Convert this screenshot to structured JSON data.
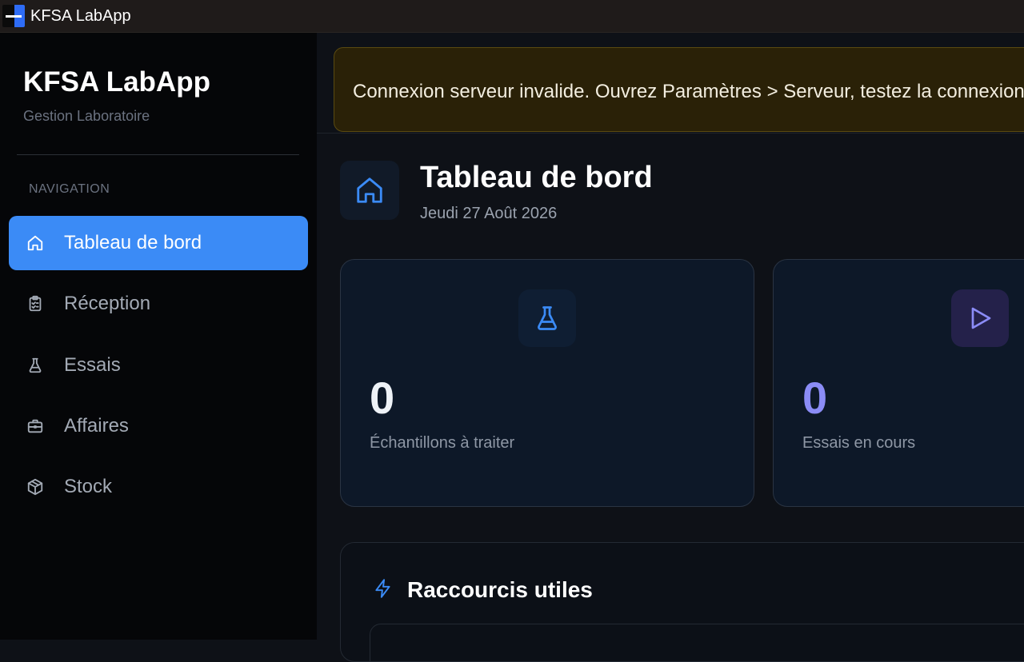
{
  "window": {
    "title": "KFSA LabApp"
  },
  "sidebar": {
    "brand_title": "KFSA LabApp",
    "brand_subtitle": "Gestion Laboratoire",
    "nav_heading": "NAVIGATION",
    "items": [
      {
        "label": "Tableau de bord",
        "icon": "home-icon",
        "active": true
      },
      {
        "label": "Réception",
        "icon": "clipboard-icon",
        "active": false
      },
      {
        "label": "Essais",
        "icon": "flask-icon",
        "active": false
      },
      {
        "label": "Affaires",
        "icon": "briefcase-icon",
        "active": false
      },
      {
        "label": "Stock",
        "icon": "box-icon",
        "active": false
      }
    ]
  },
  "banner": {
    "text": "Connexion serveur invalide. Ouvrez Paramètres > Serveur, testez la connexion",
    "color": "#2a2107"
  },
  "header": {
    "title": "Tableau de bord",
    "date": "Jeudi 27 Août 2026",
    "icon": "home-icon"
  },
  "stats": [
    {
      "value": "0",
      "label": "Échantillons à traiter",
      "icon": "flask-icon",
      "color": "#3b8bf6"
    },
    {
      "value": "0",
      "label": "Essais en cours",
      "icon": "play-icon",
      "color": "#8b8cf6"
    }
  ],
  "shortcuts": {
    "title": "Raccourcis utiles",
    "icon": "bolt-icon"
  },
  "colors": {
    "accent": "#3b8bf6",
    "background": "#0e1117",
    "sidebar": "#050608"
  }
}
